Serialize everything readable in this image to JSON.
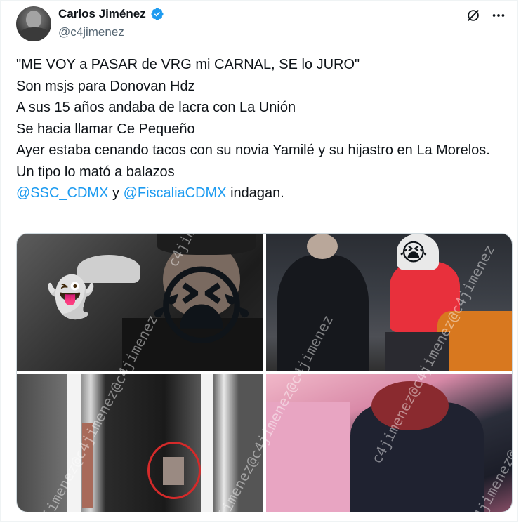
{
  "author": {
    "display_name": "Carlos Jiménez",
    "handle": "@c4jimenez",
    "verified_color": "#1d9bf0"
  },
  "actions": {
    "grok_icon": "grok-icon",
    "more_icon": "more-icon"
  },
  "tweet": {
    "lines": [
      "\"ME VOY a PASAR de VRG mi CARNAL, SE lo JURO\"",
      "Son msjs para Donovan Hdz",
      "A sus 15 años andaba de lacra con La Unión",
      "Se hacia llamar Ce Pequeño",
      "Ayer estaba cenando tacos con su novia Yamilé y su hijastro en La Morelos.",
      "Un tipo lo mató a balazos"
    ],
    "last_line": {
      "mention_1": "@SSC_CDMX",
      "joiner": " y ",
      "mention_2": "@FiscaliaCDMX",
      "suffix": " indagan."
    }
  },
  "media": {
    "watermark": "c4jimenez@c4jimenez@c4jimenez",
    "photo_1": {
      "emoji_ghost": "👻",
      "emoji_crying": "😭"
    },
    "photo_2": {
      "emoji_crying": "😭"
    }
  }
}
